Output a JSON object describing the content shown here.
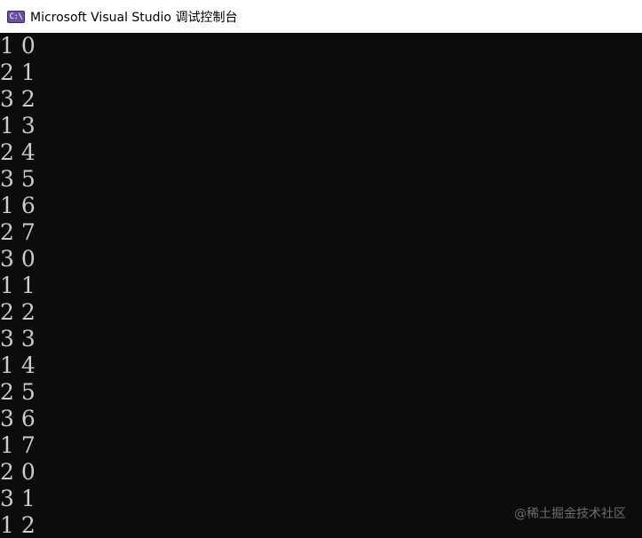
{
  "window": {
    "icon_text": "C:\\",
    "title": "Microsoft Visual Studio 调试控制台"
  },
  "console": {
    "lines": [
      "1 0",
      "2 1",
      "3 2",
      "1 3",
      "2 4",
      "3 5",
      "1 6",
      "2 7",
      "3 0",
      "1 1",
      "2 2",
      "3 3",
      "1 4",
      "2 5",
      "3 6",
      "1 7",
      "2 0",
      "3 1",
      "1 2"
    ]
  },
  "watermark": "@稀土掘金技术社区",
  "colors": {
    "console_background": "#0c0c0c",
    "console_text": "#cccccc",
    "titlebar_background": "#ffffff",
    "icon_background": "#6b4fa3"
  }
}
